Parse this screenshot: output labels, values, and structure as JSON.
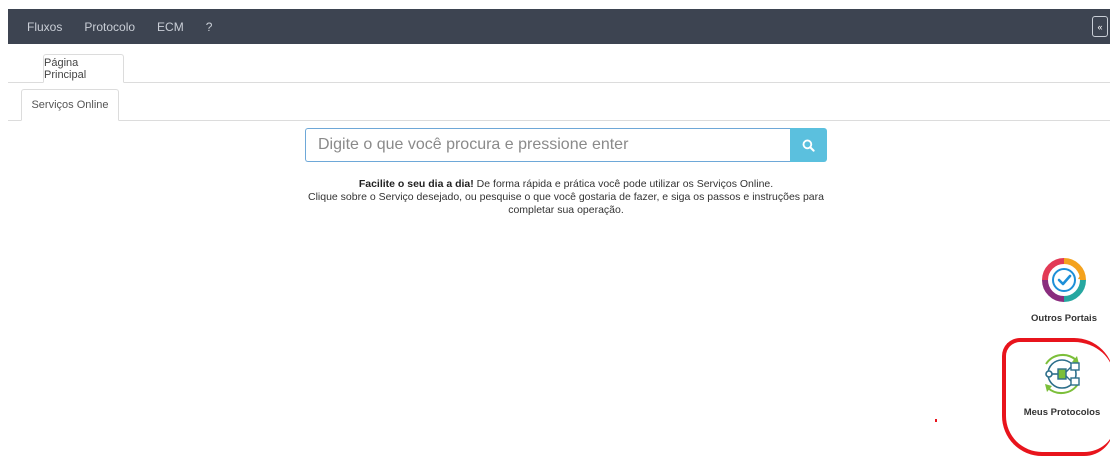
{
  "topnav": {
    "items": [
      "Fluxos",
      "Protocolo",
      "ECM",
      "?"
    ],
    "collapse_icon": "double-chevron-up-icon"
  },
  "tabs": {
    "main": "Página Principal",
    "sub": "Serviços Online"
  },
  "search": {
    "placeholder": "Digite o que você procura e pressione enter",
    "value": "",
    "button_icon": "search-icon",
    "button_color": "#5bc0de"
  },
  "intro": {
    "bold": "Facilite o seu dia a dia!",
    "line1_rest": " De forma rápida e prática você pode utilizar os Serviços Online.",
    "line2": "Clique sobre o Serviço desejado, ou pesquise o que você gostaria de fazer, e siga os passos e instruções para",
    "line3": "completar sua operação."
  },
  "side_links": [
    {
      "label": "Outros Portais",
      "icon": "portals-cycle-icon"
    },
    {
      "label": "Meus Protocolos",
      "icon": "protocols-flow-icon"
    }
  ],
  "colors": {
    "nav_bg": "#3d4451",
    "accent": "#5bc0de",
    "annotation": "#e8141c"
  }
}
